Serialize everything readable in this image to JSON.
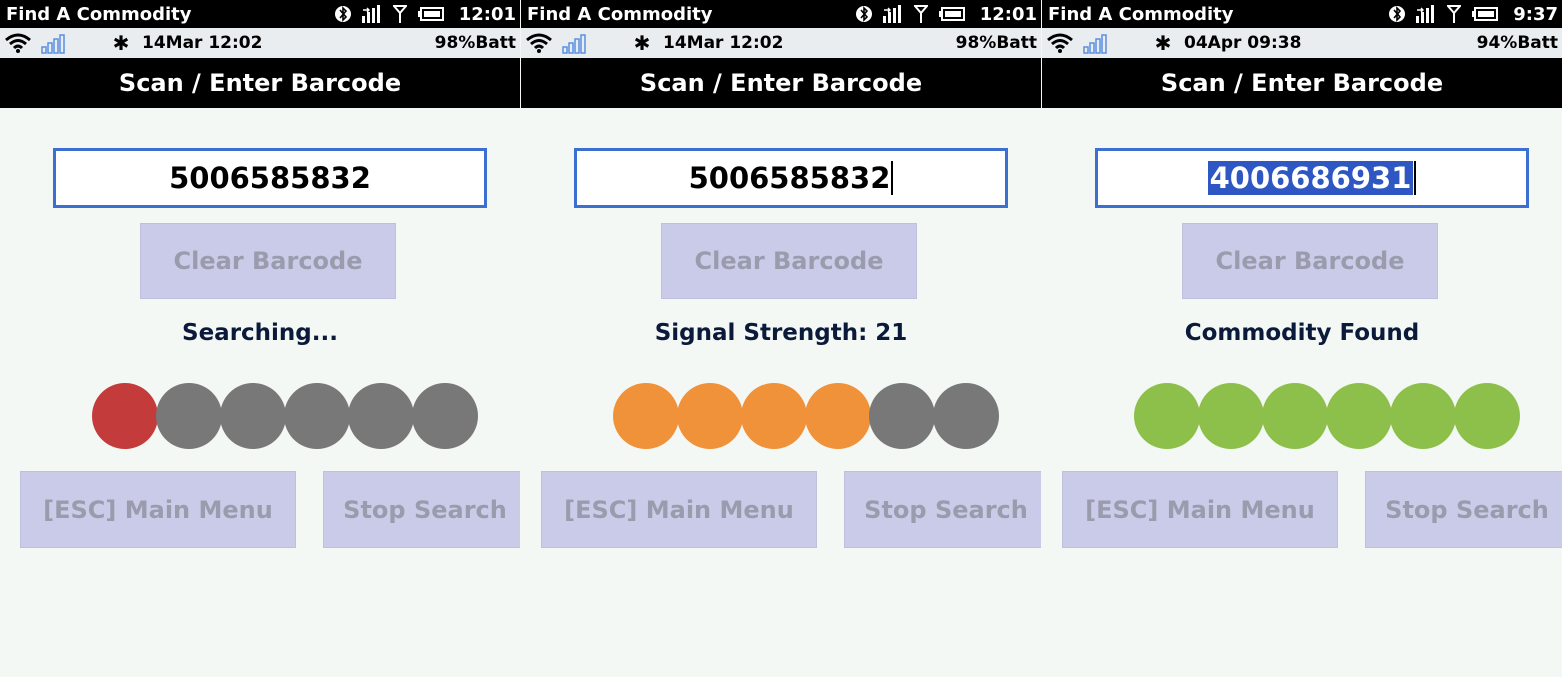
{
  "colors": {
    "dot_red": "#c43b3b",
    "dot_gray": "#787878",
    "dot_orange": "#f0923a",
    "dot_green": "#8cc04a",
    "input_border": "#3b6fd1",
    "button_bg": "#c9cbe8",
    "button_text": "#9a9cae"
  },
  "panels": [
    {
      "app_title": "Find A Commodity",
      "clock": "12:01",
      "status_date": "14Mar 12:02",
      "status_battery": "98%Batt",
      "header": "Scan / Enter Barcode",
      "barcode": "5006585832",
      "barcode_caret": false,
      "barcode_selected": false,
      "clear_label": "Clear Barcode",
      "status_text": "Searching...",
      "signal_level": 1,
      "signal_max": 6,
      "indicator_color": "#c43b3b",
      "menu_label": "[ESC] Main Menu",
      "stop_label": "Stop Search"
    },
    {
      "app_title": "Find A Commodity",
      "clock": "12:01",
      "status_date": "14Mar 12:02",
      "status_battery": "98%Batt",
      "header": "Scan / Enter Barcode",
      "barcode": "5006585832",
      "barcode_caret": true,
      "barcode_selected": false,
      "clear_label": "Clear Barcode",
      "status_text": "Signal Strength: 21",
      "signal_level": 4,
      "signal_max": 6,
      "indicator_color": "#f0923a",
      "menu_label": "[ESC] Main Menu",
      "stop_label": "Stop Search"
    },
    {
      "app_title": "Find A Commodity",
      "clock": "9:37",
      "status_date": "04Apr 09:38",
      "status_battery": "94%Batt",
      "header": "Scan / Enter Barcode",
      "barcode": "4006686931",
      "barcode_caret": true,
      "barcode_selected": true,
      "clear_label": "Clear Barcode",
      "status_text": "Commodity Found",
      "signal_level": 6,
      "signal_max": 6,
      "indicator_color": "#8cc04a",
      "menu_label": "[ESC] Main Menu",
      "stop_label": "Stop Search"
    }
  ]
}
